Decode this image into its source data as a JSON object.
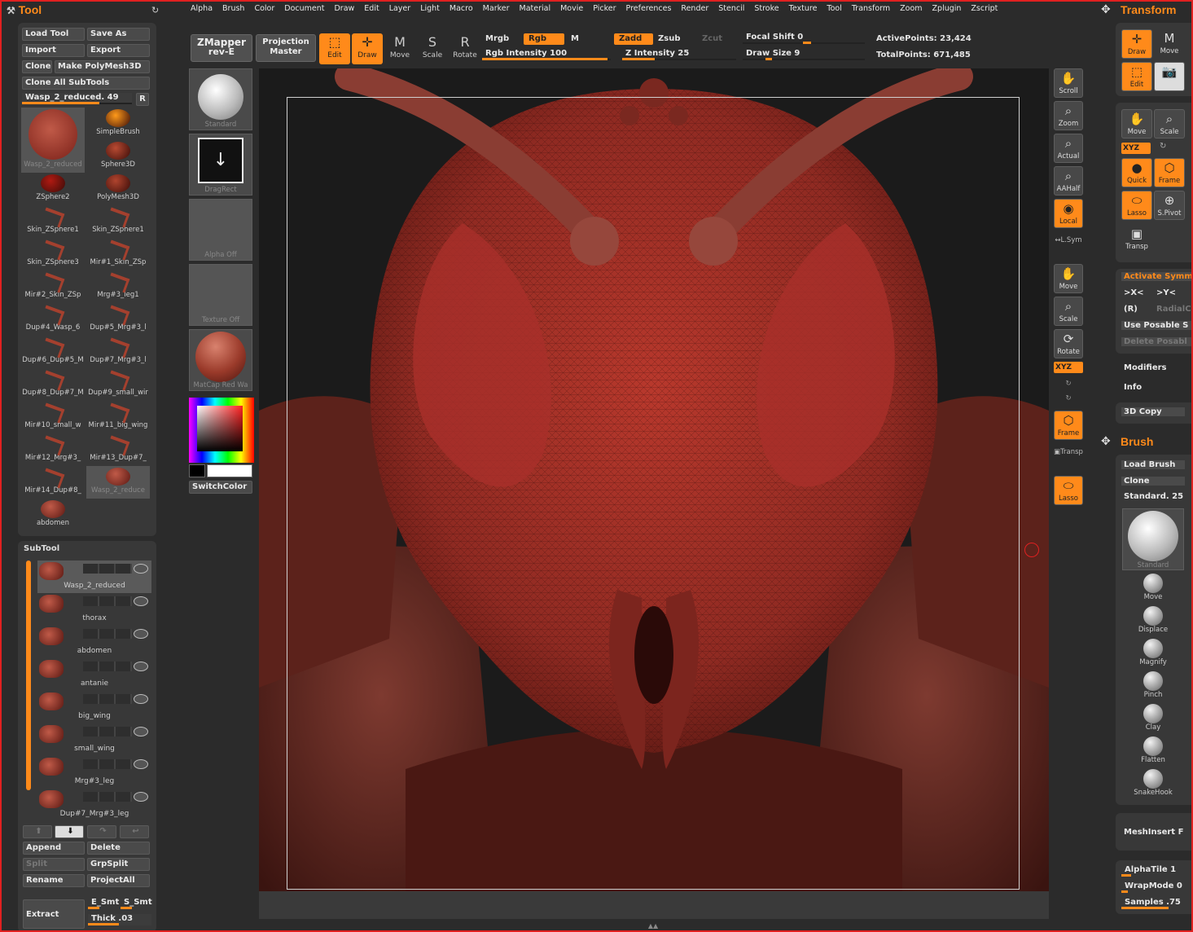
{
  "menu": [
    "Alpha",
    "Brush",
    "Color",
    "Document",
    "Draw",
    "Edit",
    "Layer",
    "Light",
    "Macro",
    "Marker",
    "Material",
    "Movie",
    "Picker",
    "Preferences",
    "Render",
    "Stencil",
    "Stroke",
    "Texture",
    "Tool",
    "Transform",
    "Zoom",
    "Zplugin",
    "Zscript"
  ],
  "tool_panel": {
    "title": "Tool",
    "buttons": {
      "load_tool": "Load Tool",
      "save_as": "Save As",
      "import": "Import",
      "export": "Export",
      "clone": "Clone",
      "make_polymesh": "Make PolyMesh3D",
      "clone_all": "Clone All SubTools"
    },
    "current_tool_slider": "Wasp_2_reduced. 49",
    "r_button": "R",
    "tools": [
      "Wasp_2_reduced",
      "SimpleBrush",
      "",
      "Sphere3D",
      "ZSphere2",
      "PolyMesh3D",
      "Skin_ZSphere1",
      "Skin_ZSphere1",
      "Skin_ZSphere3",
      "Mir#1_Skin_ZSp",
      "Mir#2_Skin_ZSp",
      "Mrg#3_leg1",
      "Dup#4_Wasp_6",
      "Dup#5_Mrg#3_l",
      "Dup#6_Dup#5_M",
      "Dup#7_Mrg#3_l",
      "Dup#8_Dup#7_M",
      "Dup#9_small_wir",
      "Mir#10_small_w",
      "Mir#11_big_wing",
      "Mir#12_Mrg#3_",
      "Mir#13_Dup#7_",
      "Mir#14_Dup#8_",
      "Wasp_2_reduce",
      "abdomen"
    ]
  },
  "subtool_panel": {
    "title": "SubTool",
    "items": [
      "Wasp_2_reduced",
      "thorax",
      "abdomen",
      "antanie",
      "big_wing",
      "small_wing",
      "Mrg#3_leg",
      "Dup#7_Mrg#3_leg"
    ],
    "buttons": {
      "append": "Append",
      "delete": "Delete",
      "split": "Split",
      "grpsplit": "GrpSplit",
      "rename": "Rename",
      "projectall": "ProjectAll",
      "extract": "Extract"
    },
    "extract_opts": {
      "e_smt": "E_Smt",
      "s_smt": "S_Smt",
      "thick": "Thick .03"
    }
  },
  "toolbar": {
    "zmapper": "ZMapper",
    "zmapper_sub": "rev-E",
    "projection": "Projection",
    "projection_sub": "Master",
    "edit": "Edit",
    "draw": "Draw",
    "move": "Move",
    "scale": "Scale",
    "rotate": "Rotate",
    "mrgb": "Mrgb",
    "rgb": "Rgb",
    "m": "M",
    "rgb_intensity": "Rgb Intensity 100",
    "zadd": "Zadd",
    "zsub": "Zsub",
    "zcut": "Zcut",
    "z_intensity": "Z Intensity 25",
    "focal_shift": "Focal Shift 0",
    "draw_size": "Draw Size 9",
    "active_points": "ActivePoints: 23,424",
    "total_points": "TotalPoints: 671,485"
  },
  "left_shelf": {
    "brush": "Standard",
    "stroke": "DragRect",
    "alpha": "Alpha Off",
    "texture": "Texture Off",
    "material": "MatCap Red Wa",
    "switch_color": "SwitchColor"
  },
  "right_shelf": [
    "Scroll",
    "Zoom",
    "Actual",
    "AAHalf",
    "Local",
    "L.Sym",
    "Move",
    "Scale",
    "Rotate",
    "XYZ",
    "Frame",
    "Transp",
    "Lasso"
  ],
  "transform_panel": {
    "title": "Transform",
    "draw": "Draw",
    "move": "Move",
    "edit": "Edit",
    "move2": "Move",
    "scale2": "Scale",
    "xyz": "XYZ",
    "quick": "Quick",
    "frame": "Frame",
    "lasso": "Lasso",
    "spivot": "S.Pivot",
    "transp": "Transp",
    "activate_sym": "Activate Symm",
    "x": ">X<",
    "y": ">Y<",
    "r": "(R)",
    "radial": "RadialC",
    "use_posable": "Use Posable S",
    "delete_posable": "Delete Posabl",
    "modifiers": "Modifiers",
    "info": "Info",
    "copy3d": "3D Copy"
  },
  "brush_panel": {
    "title": "Brush",
    "load_brush": "Load Brush",
    "clone": "Clone",
    "current": "Standard. 25",
    "items": [
      "Standard",
      "Move",
      "Displace",
      "Magnify",
      "Pinch",
      "Clay",
      "Flatten",
      "SnakeHook"
    ],
    "meshinsert": "MeshInsert F",
    "alpha_tile": "AlphaTile 1",
    "wrap_mode": "WrapMode 0",
    "samples": "Samples .75"
  },
  "colors": {
    "accent": "#ff8a1a",
    "panel": "#383838",
    "model": "#8f2a24"
  }
}
